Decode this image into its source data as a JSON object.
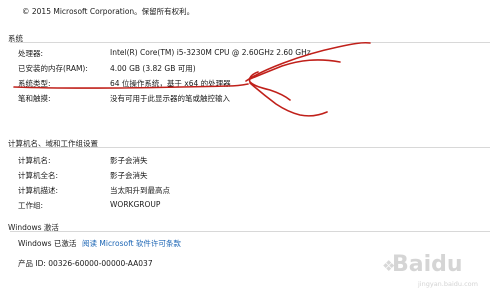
{
  "copyright": "© 2015 Microsoft Corporation。保留所有权利。",
  "system": {
    "title": "系统",
    "rows": [
      {
        "label": "处理器:",
        "value": "Intel(R) Core(TM) i5-3230M CPU @ 2.60GHz   2.60 GHz"
      },
      {
        "label": "已安装的内存(RAM):",
        "value": "4.00 GB (3.82 GB 可用)"
      },
      {
        "label": "系统类型:",
        "value": "64 位操作系统，基于 x64 的处理器"
      },
      {
        "label": "笔和触摸:",
        "value": "没有可用于此显示器的笔或触控输入"
      }
    ]
  },
  "computer": {
    "title": "计算机名、域和工作组设置",
    "rows": [
      {
        "label": "计算机名:",
        "value": "影子会消失"
      },
      {
        "label": "计算机全名:",
        "value": "影子会消失"
      },
      {
        "label": "计算机描述:",
        "value": "当太阳升到最高点"
      },
      {
        "label": "工作组:",
        "value": "WORKGROUP"
      }
    ]
  },
  "activation": {
    "title": "Windows 激活",
    "status": "Windows 已激活",
    "license_link": "阅读 Microsoft 软件许可条款",
    "product_id": "产品 ID: 00326-60000-00000-AA037"
  },
  "watermark": {
    "logo": "Baidu",
    "url": "jingyan.baidu.com"
  },
  "colors": {
    "annotation": "#c0201a",
    "link": "#1a64b4",
    "rule": "#d8d8d8"
  }
}
